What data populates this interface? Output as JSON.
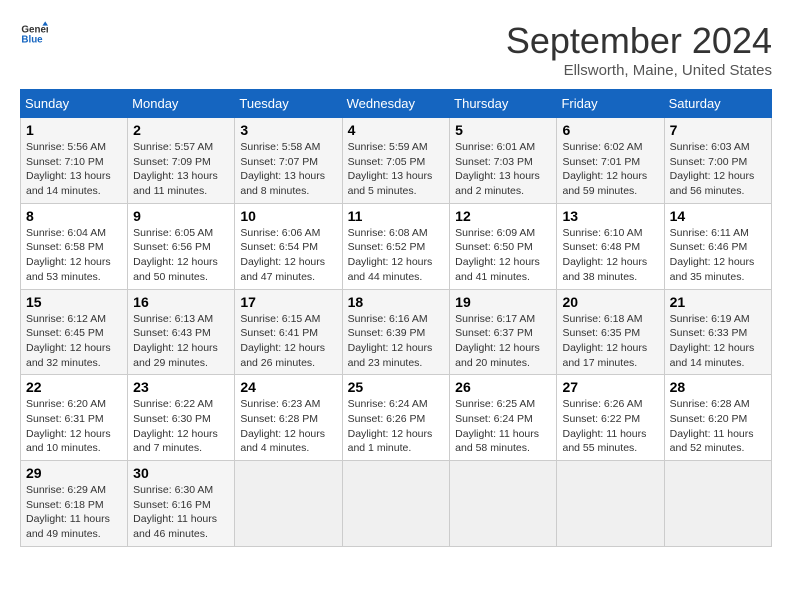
{
  "header": {
    "logo_line1": "General",
    "logo_line2": "Blue",
    "title": "September 2024",
    "subtitle": "Ellsworth, Maine, United States"
  },
  "days_of_week": [
    "Sunday",
    "Monday",
    "Tuesday",
    "Wednesday",
    "Thursday",
    "Friday",
    "Saturday"
  ],
  "weeks": [
    [
      {
        "day": "1",
        "info": "Sunrise: 5:56 AM\nSunset: 7:10 PM\nDaylight: 13 hours and 14 minutes."
      },
      {
        "day": "2",
        "info": "Sunrise: 5:57 AM\nSunset: 7:09 PM\nDaylight: 13 hours and 11 minutes."
      },
      {
        "day": "3",
        "info": "Sunrise: 5:58 AM\nSunset: 7:07 PM\nDaylight: 13 hours and 8 minutes."
      },
      {
        "day": "4",
        "info": "Sunrise: 5:59 AM\nSunset: 7:05 PM\nDaylight: 13 hours and 5 minutes."
      },
      {
        "day": "5",
        "info": "Sunrise: 6:01 AM\nSunset: 7:03 PM\nDaylight: 13 hours and 2 minutes."
      },
      {
        "day": "6",
        "info": "Sunrise: 6:02 AM\nSunset: 7:01 PM\nDaylight: 12 hours and 59 minutes."
      },
      {
        "day": "7",
        "info": "Sunrise: 6:03 AM\nSunset: 7:00 PM\nDaylight: 12 hours and 56 minutes."
      }
    ],
    [
      {
        "day": "8",
        "info": "Sunrise: 6:04 AM\nSunset: 6:58 PM\nDaylight: 12 hours and 53 minutes."
      },
      {
        "day": "9",
        "info": "Sunrise: 6:05 AM\nSunset: 6:56 PM\nDaylight: 12 hours and 50 minutes."
      },
      {
        "day": "10",
        "info": "Sunrise: 6:06 AM\nSunset: 6:54 PM\nDaylight: 12 hours and 47 minutes."
      },
      {
        "day": "11",
        "info": "Sunrise: 6:08 AM\nSunset: 6:52 PM\nDaylight: 12 hours and 44 minutes."
      },
      {
        "day": "12",
        "info": "Sunrise: 6:09 AM\nSunset: 6:50 PM\nDaylight: 12 hours and 41 minutes."
      },
      {
        "day": "13",
        "info": "Sunrise: 6:10 AM\nSunset: 6:48 PM\nDaylight: 12 hours and 38 minutes."
      },
      {
        "day": "14",
        "info": "Sunrise: 6:11 AM\nSunset: 6:46 PM\nDaylight: 12 hours and 35 minutes."
      }
    ],
    [
      {
        "day": "15",
        "info": "Sunrise: 6:12 AM\nSunset: 6:45 PM\nDaylight: 12 hours and 32 minutes."
      },
      {
        "day": "16",
        "info": "Sunrise: 6:13 AM\nSunset: 6:43 PM\nDaylight: 12 hours and 29 minutes."
      },
      {
        "day": "17",
        "info": "Sunrise: 6:15 AM\nSunset: 6:41 PM\nDaylight: 12 hours and 26 minutes."
      },
      {
        "day": "18",
        "info": "Sunrise: 6:16 AM\nSunset: 6:39 PM\nDaylight: 12 hours and 23 minutes."
      },
      {
        "day": "19",
        "info": "Sunrise: 6:17 AM\nSunset: 6:37 PM\nDaylight: 12 hours and 20 minutes."
      },
      {
        "day": "20",
        "info": "Sunrise: 6:18 AM\nSunset: 6:35 PM\nDaylight: 12 hours and 17 minutes."
      },
      {
        "day": "21",
        "info": "Sunrise: 6:19 AM\nSunset: 6:33 PM\nDaylight: 12 hours and 14 minutes."
      }
    ],
    [
      {
        "day": "22",
        "info": "Sunrise: 6:20 AM\nSunset: 6:31 PM\nDaylight: 12 hours and 10 minutes."
      },
      {
        "day": "23",
        "info": "Sunrise: 6:22 AM\nSunset: 6:30 PM\nDaylight: 12 hours and 7 minutes."
      },
      {
        "day": "24",
        "info": "Sunrise: 6:23 AM\nSunset: 6:28 PM\nDaylight: 12 hours and 4 minutes."
      },
      {
        "day": "25",
        "info": "Sunrise: 6:24 AM\nSunset: 6:26 PM\nDaylight: 12 hours and 1 minute."
      },
      {
        "day": "26",
        "info": "Sunrise: 6:25 AM\nSunset: 6:24 PM\nDaylight: 11 hours and 58 minutes."
      },
      {
        "day": "27",
        "info": "Sunrise: 6:26 AM\nSunset: 6:22 PM\nDaylight: 11 hours and 55 minutes."
      },
      {
        "day": "28",
        "info": "Sunrise: 6:28 AM\nSunset: 6:20 PM\nDaylight: 11 hours and 52 minutes."
      }
    ],
    [
      {
        "day": "29",
        "info": "Sunrise: 6:29 AM\nSunset: 6:18 PM\nDaylight: 11 hours and 49 minutes."
      },
      {
        "day": "30",
        "info": "Sunrise: 6:30 AM\nSunset: 6:16 PM\nDaylight: 11 hours and 46 minutes."
      },
      {
        "day": "",
        "info": ""
      },
      {
        "day": "",
        "info": ""
      },
      {
        "day": "",
        "info": ""
      },
      {
        "day": "",
        "info": ""
      },
      {
        "day": "",
        "info": ""
      }
    ]
  ]
}
